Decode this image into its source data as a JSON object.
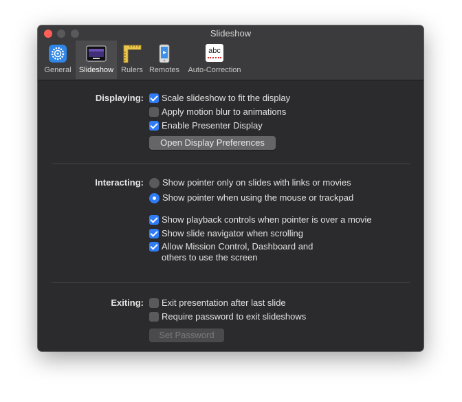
{
  "window": {
    "title": "Slideshow"
  },
  "colors": {
    "accent": "#2f7cf6",
    "close": "#ff5f57",
    "background": "#2b2b2d"
  },
  "tabs": [
    {
      "label": "General",
      "icon": "gear-icon"
    },
    {
      "label": "Slideshow",
      "icon": "slideshow-icon",
      "selected": true
    },
    {
      "label": "Rulers",
      "icon": "ruler-icon"
    },
    {
      "label": "Remotes",
      "icon": "remote-icon"
    },
    {
      "label": "Auto-Correction",
      "icon": "abc-icon"
    }
  ],
  "tab_icon_text": {
    "abc": "abc"
  },
  "displaying": {
    "label": "Displaying:",
    "options": [
      {
        "label": "Scale slideshow to fit the display",
        "checked": true
      },
      {
        "label": "Apply motion blur to animations",
        "checked": false
      },
      {
        "label": "Enable Presenter Display",
        "checked": true
      }
    ],
    "button": "Open Display Preferences"
  },
  "interacting": {
    "label": "Interacting:",
    "radios": [
      {
        "label": "Show pointer only on slides with links or movies",
        "selected": false
      },
      {
        "label": "Show pointer when using the mouse or trackpad",
        "selected": true
      }
    ],
    "options": [
      {
        "label": "Show playback controls when pointer is over a movie",
        "checked": true
      },
      {
        "label": "Show slide navigator when scrolling",
        "checked": true
      },
      {
        "label": "Allow Mission Control, Dashboard and",
        "label2": "others to use the screen",
        "checked": true
      }
    ]
  },
  "exiting": {
    "label": "Exiting:",
    "options": [
      {
        "label": "Exit presentation after last slide",
        "checked": false
      },
      {
        "label": "Require password to exit slideshows",
        "checked": false
      }
    ],
    "button": "Set Password"
  }
}
